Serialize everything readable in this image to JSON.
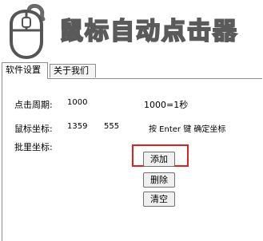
{
  "app": {
    "title": "鼠标自动点击器"
  },
  "tabs": [
    {
      "label": "软件设置",
      "active": true
    },
    {
      "label": "关于我们",
      "active": false
    }
  ],
  "form": {
    "period_label": "点击周期:",
    "period_value": "1000",
    "period_hint": "1000=1秒",
    "coord_label": "鼠标坐标:",
    "coord_x": "1359",
    "coord_y": "555",
    "coord_hint": "按 Enter 键 确定坐标",
    "batch_label": "批里坐标:"
  },
  "buttons": {
    "add": "添加",
    "delete": "删除",
    "clear": "清空"
  },
  "colors": {
    "highlight": "#e02020",
    "tab_border": "#8c8c8c"
  }
}
